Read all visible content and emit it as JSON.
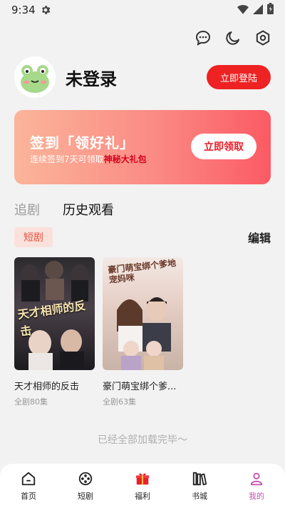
{
  "status": {
    "time": "9:34"
  },
  "profile": {
    "name": "未登录",
    "login_label": "立即登陆"
  },
  "signin": {
    "title": "签到「领好礼」",
    "subtitle_prefix": "连续签到7天可领取",
    "subtitle_highlight": "神秘大礼包",
    "claim_label": "立即领取"
  },
  "tabs": [
    {
      "label": "追剧",
      "active": false
    },
    {
      "label": "历史观看",
      "active": true
    }
  ],
  "section": {
    "chip": "短剧",
    "edit_label": "编辑"
  },
  "dramas": [
    {
      "poster_title": "天才相师的反击",
      "name": "天才相师的反击",
      "meta": "全剧80集"
    },
    {
      "poster_title": "豪门萌宝绑个爹地宠妈咪",
      "name": "豪门萌宝绑个爹...",
      "meta": "全剧63集"
    }
  ],
  "end_text": "已经全部加载完毕〜",
  "nav": [
    {
      "label": "首页",
      "icon": "home-icon"
    },
    {
      "label": "短剧",
      "icon": "film-reel-icon"
    },
    {
      "label": "福利",
      "icon": "gift-icon"
    },
    {
      "label": "书城",
      "icon": "books-icon"
    },
    {
      "label": "我的",
      "icon": "profile-icon",
      "active": true
    }
  ],
  "colors": {
    "accent_red": "#ee2222",
    "active_nav": "#c64fb2",
    "chip_bg": "#fbe1dc",
    "chip_text": "#e5533d"
  }
}
